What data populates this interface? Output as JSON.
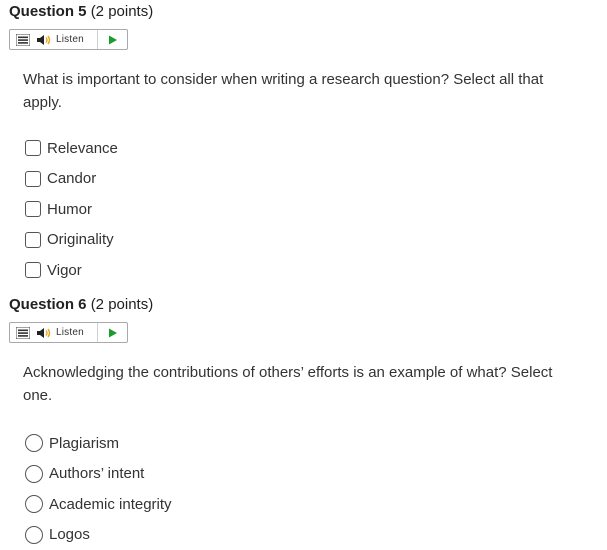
{
  "questions": [
    {
      "label": "Question 5",
      "points": "(2 points)",
      "listen_label": "Listen",
      "prompt": "What is important to consider when writing a research question? Select all that apply.",
      "input_type": "checkbox",
      "options": [
        {
          "label": "Relevance",
          "checked": false
        },
        {
          "label": "Candor",
          "checked": false
        },
        {
          "label": "Humor",
          "checked": false
        },
        {
          "label": "Originality",
          "checked": false
        },
        {
          "label": "Vigor",
          "checked": false
        }
      ]
    },
    {
      "label": "Question 6",
      "points": "(2 points)",
      "listen_label": "Listen",
      "prompt": "Acknowledging the contributions of others’ efforts is an example of what? Select one.",
      "input_type": "radio",
      "options": [
        {
          "label": "Plagiarism",
          "checked": false
        },
        {
          "label": "Authors’ intent",
          "checked": false
        },
        {
          "label": "Academic integrity",
          "checked": false
        },
        {
          "label": "Logos",
          "checked": false
        }
      ]
    }
  ],
  "icons": {
    "menu": "menu-lines-icon",
    "speaker": "speaker-icon",
    "play": "play-icon"
  },
  "colors": {
    "play": "#1a9d2c",
    "text": "#333333",
    "border": "#a7a9ab"
  }
}
